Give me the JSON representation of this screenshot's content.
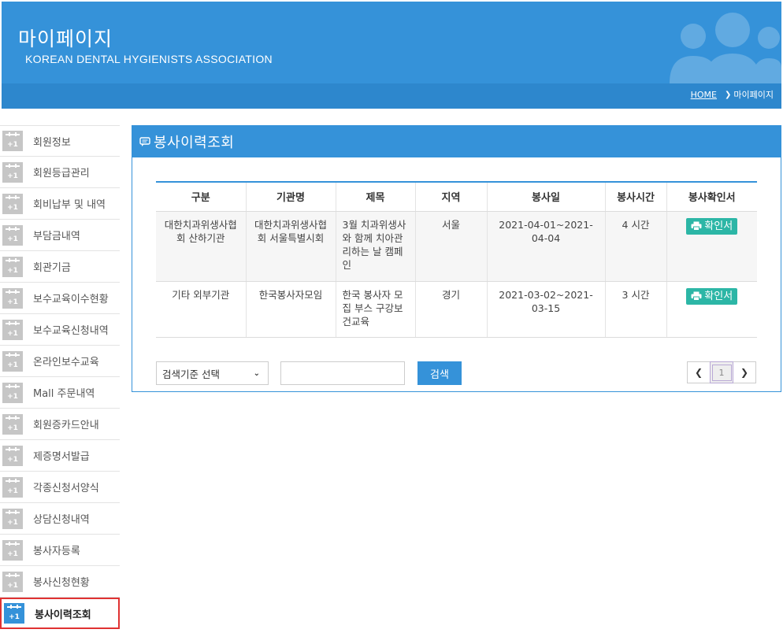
{
  "header": {
    "title": "마이페이지",
    "subtitle": "KOREAN DENTAL HYGIENISTS ASSOCIATION",
    "accent_color": "#3592d9"
  },
  "breadcrumb": {
    "home": "HOME",
    "current": "마이페이지",
    "separator_icon": "chevron-right-icon"
  },
  "sidebar": {
    "icon": "calendar-plus-icon",
    "items": [
      {
        "label": "회원정보"
      },
      {
        "label": "회원등급관리"
      },
      {
        "label": "회비납부 및 내역"
      },
      {
        "label": "부담금내역"
      },
      {
        "label": "회관기금"
      },
      {
        "label": "보수교육이수현황"
      },
      {
        "label": "보수교육신청내역"
      },
      {
        "label": "온라인보수교육"
      },
      {
        "label": "Mall 주문내역"
      },
      {
        "label": "회원증카드안내"
      },
      {
        "label": "제증명서발급"
      },
      {
        "label": "각종신청서양식"
      },
      {
        "label": "상담신청내역"
      },
      {
        "label": "봉사자등록"
      },
      {
        "label": "봉사신청현황"
      },
      {
        "label": "봉사이력조회",
        "active": true
      }
    ]
  },
  "panel": {
    "title": "봉사이력조회",
    "title_icon": "chat-icon"
  },
  "table": {
    "headers": [
      "구분",
      "기관명",
      "제목",
      "지역",
      "봉사일",
      "봉사시간",
      "봉사확인서"
    ],
    "rows": [
      {
        "category": "대한치과위생사협회 산하기관",
        "org": "대한치과위생사협회 서울특별시회",
        "title": "3월 치과위생사와 함께 치아관리하는 날 캠페인",
        "region": "서울",
        "date": "2021-04-01~2021-04-04",
        "hours": "4 시간",
        "confirm": "확인서"
      },
      {
        "category": "기타 외부기관",
        "org": "한국봉사자모임",
        "title": "한국 봉사자 모집 부스 구강보건교육",
        "region": "경기",
        "date": "2021-03-02~2021-03-15",
        "hours": "3 시간",
        "confirm": "확인서"
      }
    ]
  },
  "search": {
    "select_value": "검색기준 선택",
    "input_value": "",
    "button": "검색"
  },
  "pagination": {
    "prev_icon": "chevron-left-icon",
    "current": "1",
    "next_icon": "chevron-right-icon"
  }
}
